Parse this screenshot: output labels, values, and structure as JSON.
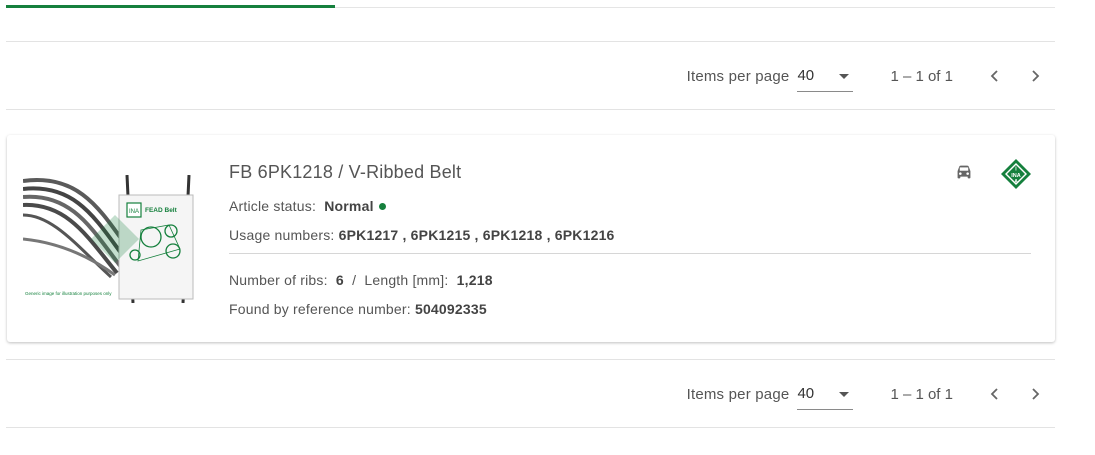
{
  "pagination_top": {
    "items_per_page_label": "Items per page",
    "page_size": "40",
    "range_label": "1 – 1 of 1"
  },
  "pagination_bottom": {
    "items_per_page_label": "Items per page",
    "page_size": "40",
    "range_label": "1 – 1 of 1"
  },
  "result": {
    "title": "FB 6PK1218 / V-Ribbed Belt",
    "article_status_label": "Article status:",
    "article_status_value": "Normal",
    "usage_numbers_label": "Usage numbers:",
    "usage_numbers_value": "6PK1217 , 6PK1215 , 6PK1218 , 6PK1216",
    "ribs_label": "Number of ribs:",
    "ribs_value": "6",
    "separator": "/",
    "length_label": "Length [mm]:",
    "length_value": "1,218",
    "reference_label": "Found by reference number:",
    "reference_value": "504092335",
    "vehicle_icon": "car-icon",
    "brand_icon": "ina-logo",
    "image": {
      "package_label": "FEAD Belt",
      "caption": "Generic image for illustration purposes only",
      "logo_text": "INA"
    }
  },
  "colors": {
    "accent": "#15803d",
    "text": "#555555",
    "divider": "#e3e3e3"
  }
}
